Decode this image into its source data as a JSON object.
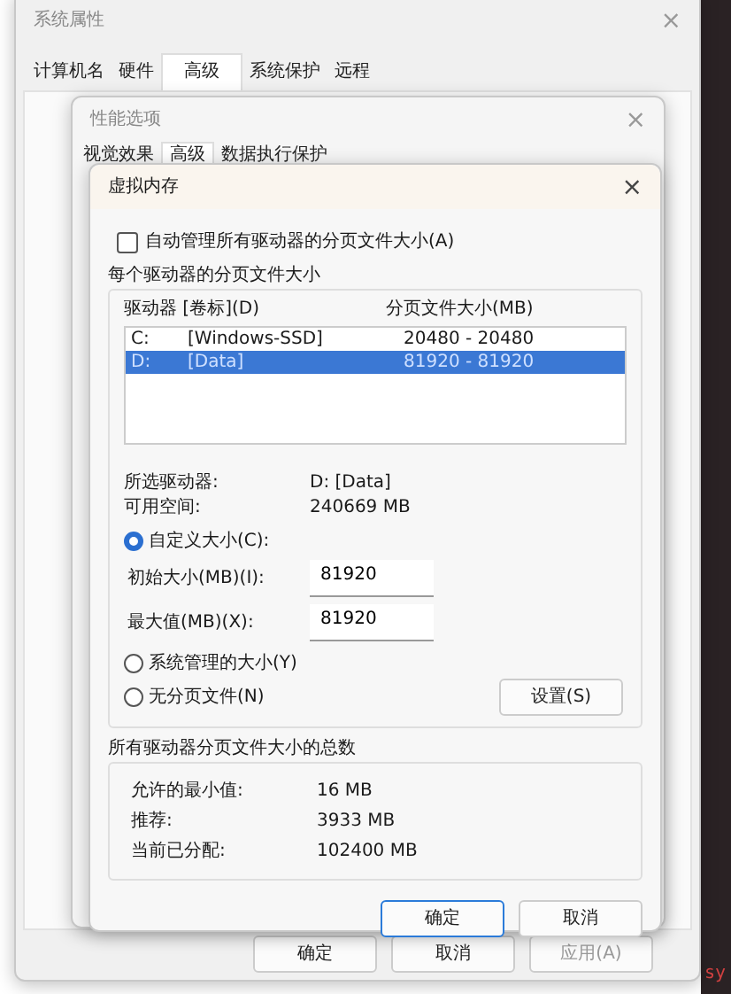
{
  "system_properties": {
    "title": "系统属性",
    "close": "×",
    "tabs": [
      {
        "label": "计算机名",
        "selected": false
      },
      {
        "label": "硬件",
        "selected": false
      },
      {
        "label": "高级",
        "selected": true
      },
      {
        "label": "系统保护",
        "selected": false
      },
      {
        "label": "远程",
        "selected": false
      }
    ],
    "buttons": [
      {
        "label": "确定",
        "disabled": false
      },
      {
        "label": "取消",
        "disabled": false
      },
      {
        "label": "应用(A)",
        "disabled": true
      }
    ]
  },
  "performance_options": {
    "title": "性能选项",
    "close": "×",
    "tabs": [
      {
        "label": "视觉效果",
        "selected": false
      },
      {
        "label": "高级",
        "selected": true
      },
      {
        "label": "数据执行保护",
        "selected": false
      }
    ]
  },
  "virtual_memory": {
    "title": "虚拟内存",
    "close": "×",
    "auto_manage": {
      "label": "自动管理所有驱动器的分页文件大小(A)",
      "checked": false
    },
    "per_drive_group": "每个驱动器的分页文件大小",
    "columns": [
      "驱动器 [卷标](D)",
      "分页文件大小(MB)"
    ],
    "drives": [
      {
        "drive": "C:",
        "label": "[Windows-SSD]",
        "size": "20480 - 20480",
        "selected": false
      },
      {
        "drive": "D:",
        "label": "[Data]",
        "size": "81920 - 81920",
        "selected": true
      }
    ],
    "info": [
      {
        "label": "所选驱动器:",
        "value": "D:  [Data]"
      },
      {
        "label": "可用空间:",
        "value": "240669 MB"
      }
    ],
    "options": [
      {
        "label": "自定义大小(C):",
        "selected": true
      },
      {
        "label": "系统管理的大小(Y)",
        "selected": false
      },
      {
        "label": "无分页文件(N)",
        "selected": false
      }
    ],
    "fields": [
      {
        "label": "初始大小(MB)(I):",
        "value": "81920"
      },
      {
        "label": "最大值(MB)(X):",
        "value": "81920"
      }
    ],
    "set_button": "设置(S)",
    "totals_group": "所有驱动器分页文件大小的总数",
    "totals": [
      {
        "label": "允许的最小值:",
        "value": "16 MB"
      },
      {
        "label": "推荐:",
        "value": "3933 MB"
      },
      {
        "label": "当前已分配:",
        "value": "102400 MB"
      }
    ],
    "buttons": [
      {
        "label": "确定",
        "focused": true
      },
      {
        "label": "取消",
        "focused": false
      }
    ]
  },
  "background_text": "sy"
}
